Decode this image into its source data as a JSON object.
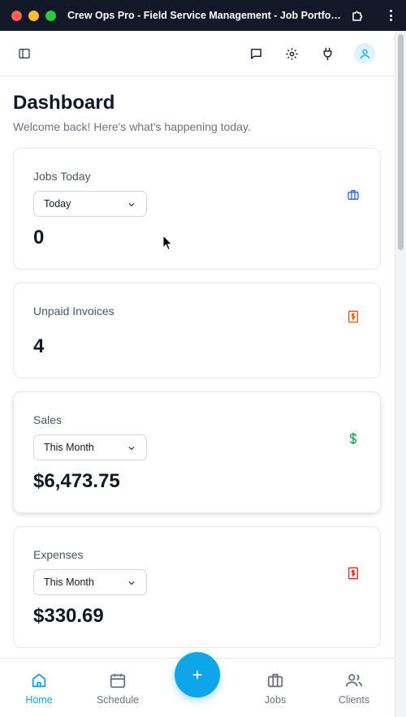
{
  "window": {
    "title": "Crew Ops Pro - Field Service Management - Job Portfolio..."
  },
  "header": {
    "icons": [
      "sidebar-toggle-icon",
      "chat-icon",
      "gear-icon",
      "plug-icon",
      "user-icon"
    ]
  },
  "dashboard": {
    "title": "Dashboard",
    "subtitle": "Welcome back! Here's what's happening today."
  },
  "cards": {
    "jobs_today": {
      "label": "Jobs Today",
      "filter": "Today",
      "value": "0",
      "icon": "briefcase-icon",
      "icon_color": "#2563eb"
    },
    "unpaid_invoices": {
      "label": "Unpaid Invoices",
      "value": "4",
      "icon": "invoice-dollar-icon",
      "icon_color": "#ea580c"
    },
    "sales": {
      "label": "Sales",
      "filter": "This Month",
      "value": "$6,473.75",
      "icon": "dollar-icon",
      "icon_color": "#16a34a"
    },
    "expenses": {
      "label": "Expenses",
      "filter": "This Month",
      "value": "$330.69",
      "icon": "receipt-dollar-icon",
      "icon_color": "#dc2626"
    }
  },
  "bottom_nav": {
    "items": [
      {
        "label": "Home",
        "icon": "home-icon",
        "active": true
      },
      {
        "label": "Schedule",
        "icon": "calendar-icon",
        "active": false
      },
      {
        "label": "Jobs",
        "icon": "briefcase-icon",
        "active": false
      },
      {
        "label": "Clients",
        "icon": "users-icon",
        "active": false
      }
    ],
    "fab_icon": "plus-icon"
  },
  "colors": {
    "accent": "#0ea5e9",
    "text_primary": "#111827",
    "text_muted": "#6b7280",
    "border": "#e5e7eb"
  }
}
